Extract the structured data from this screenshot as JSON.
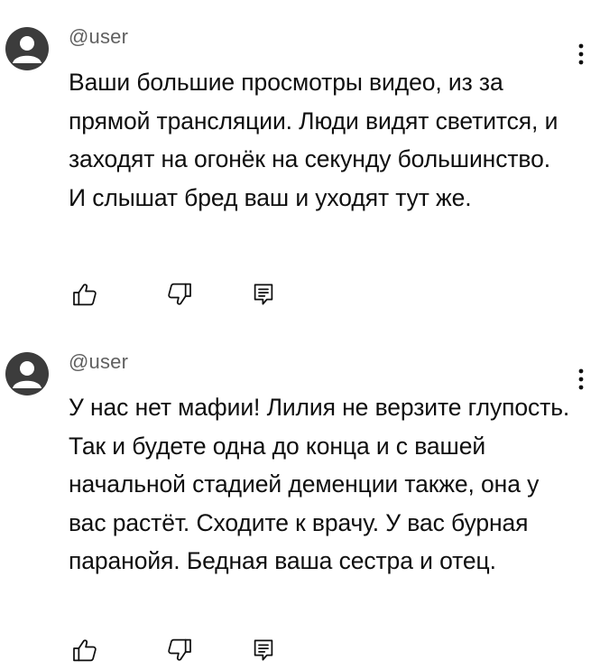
{
  "comments": [
    {
      "author": "@user",
      "text": "Ваши большие просмотры видео, из за прямой трансляции. Люди видят светится, и заходят на огонёк на секунду большинство. И слышат бред ваш и уходят тут же.",
      "icons": {
        "avatar": "avatar-icon",
        "menu": "more-vert-icon",
        "like": "thumb-up-icon",
        "dislike": "thumb-down-icon",
        "reply": "reply-icon"
      }
    },
    {
      "author": "@user",
      "text": "У нас нет мафии! Лилия не верзите глупость. Так и будете одна до конца и с вашей начальной стадией деменции также, она у вас растёт. Сходите к врачу. У вас бурная паранойя. Бедная ваша сестра и отец.",
      "icons": {
        "avatar": "avatar-icon",
        "menu": "more-vert-icon",
        "like": "thumb-up-icon",
        "dislike": "thumb-down-icon",
        "reply": "reply-icon"
      }
    }
  ],
  "colors": {
    "avatar_bg": "#3c3c3c",
    "text": "#0f0f0f",
    "author": "#606060"
  }
}
